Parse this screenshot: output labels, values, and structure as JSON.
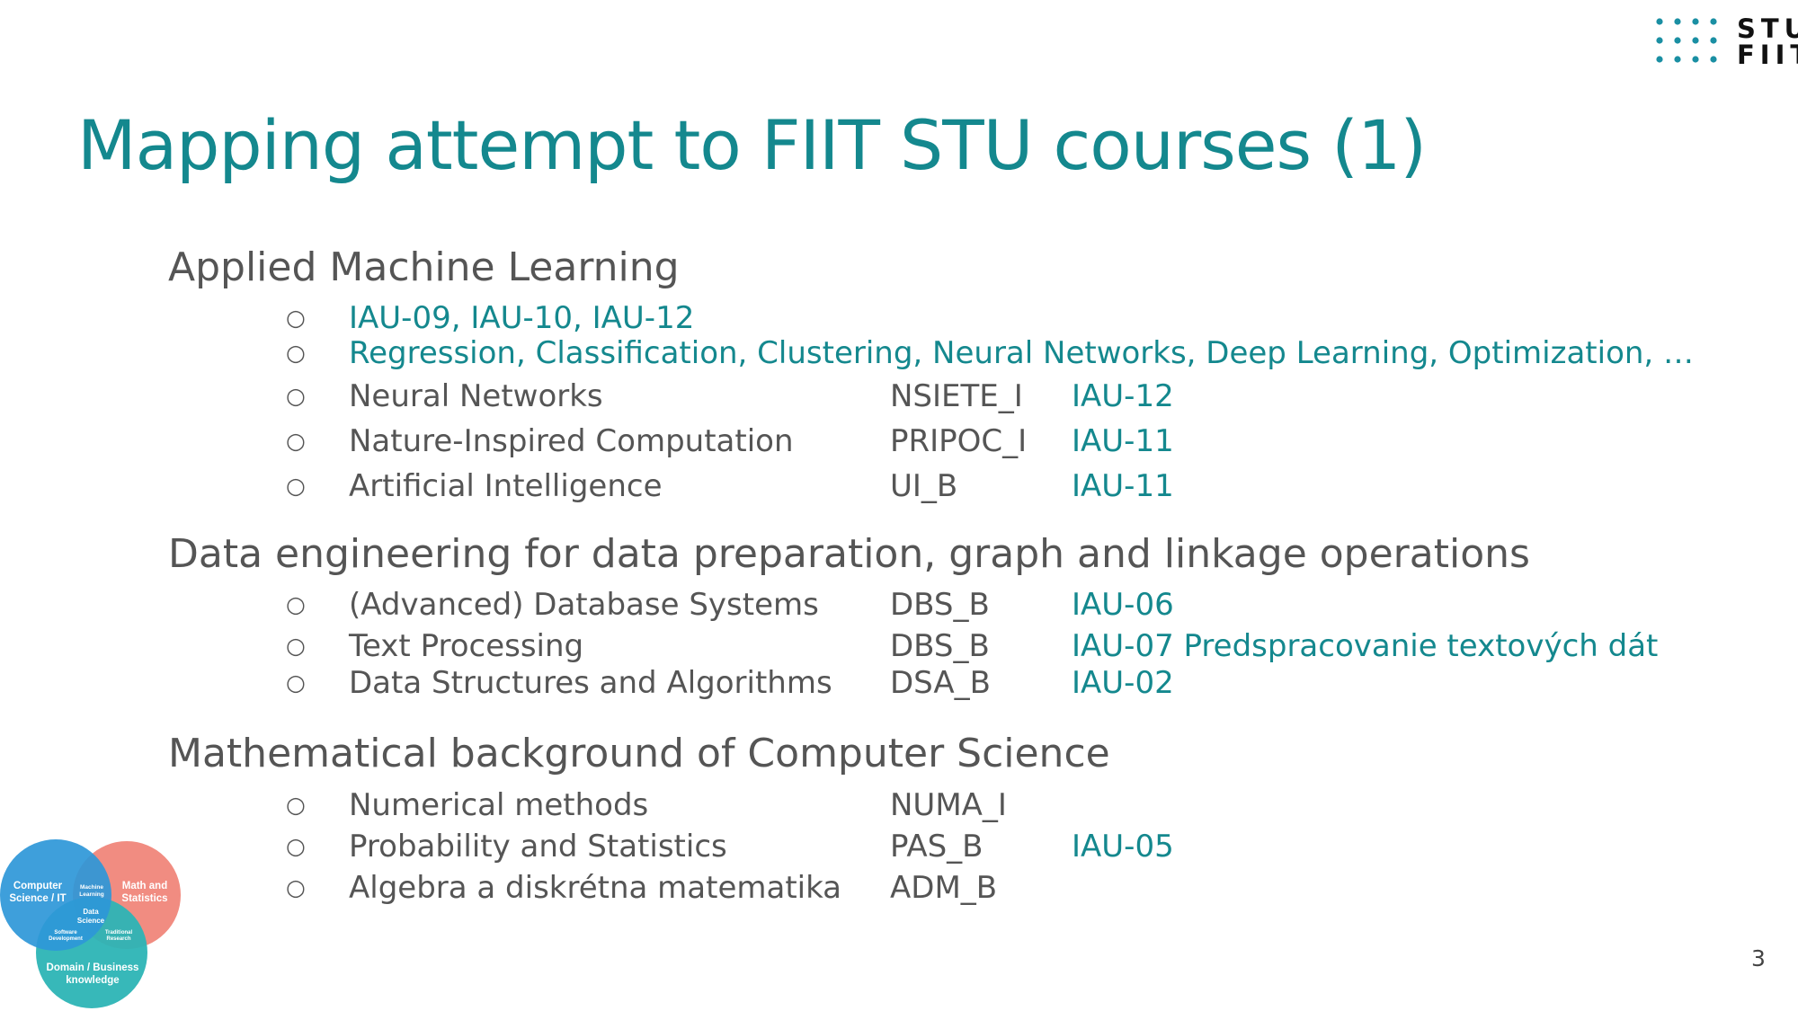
{
  "colors": {
    "accent": "#14888e",
    "text": "#555555",
    "logo_dot": "#1a8fa3",
    "venn_blue": "#2e97d8",
    "venn_salmon": "#f0867a",
    "venn_teal": "#2cb4b5"
  },
  "logo": {
    "line1": "STU",
    "line2": "FIIT"
  },
  "slide": {
    "title": "Mapping attempt to FIIT STU courses (1)",
    "page_number": "3"
  },
  "sections": [
    {
      "heading": "Applied Machine Learning",
      "notes": [
        "IAU-09, IAU-10, IAU-12",
        "Regression, Classification, Clustering, Neural Networks, Deep Learning, Optimization, …"
      ],
      "courses": [
        {
          "name": "Neural Networks",
          "code": "NSIETE_I",
          "ref": "IAU-12"
        },
        {
          "name": "Nature-Inspired Computation",
          "code": "PRIPOC_I",
          "ref": "IAU-11"
        },
        {
          "name": "Artificial Intelligence",
          "code": "UI_B",
          "ref": "IAU-11"
        }
      ]
    },
    {
      "heading": "Data engineering for data preparation, graph and linkage operations",
      "courses": [
        {
          "name": "(Advanced) Database Systems",
          "code": "DBS_B",
          "ref": "IAU-06"
        },
        {
          "name": "Text Processing",
          "code": "DBS_B",
          "ref": "IAU-07 Predspracovanie textových dát"
        },
        {
          "name": "Data Structures and Algorithms",
          "code": "DSA_B",
          "ref": "IAU-02"
        }
      ]
    },
    {
      "heading": "Mathematical background of Computer Science",
      "courses": [
        {
          "name": "Numerical methods",
          "code": "NUMA_I",
          "ref": ""
        },
        {
          "name": "Probability and Statistics",
          "code": "PAS_B",
          "ref": "IAU-05"
        },
        {
          "name": "Algebra a diskrétna matematika",
          "code": "ADM_B",
          "ref": ""
        }
      ]
    }
  ],
  "venn": {
    "cs_line1": "Computer",
    "cs_line2": "Science / IT",
    "math_line1": "Math and",
    "math_line2": "Statistics",
    "domain_line1": "Domain / Business",
    "domain_line2": "knowledge",
    "ml_line1": "Machine",
    "ml_line2": "Learning",
    "ds_line1": "Data",
    "ds_line2": "Science",
    "sd_line1": "Software",
    "sd_line2": "Development",
    "tr_line1": "Traditional",
    "tr_line2": "Research"
  }
}
